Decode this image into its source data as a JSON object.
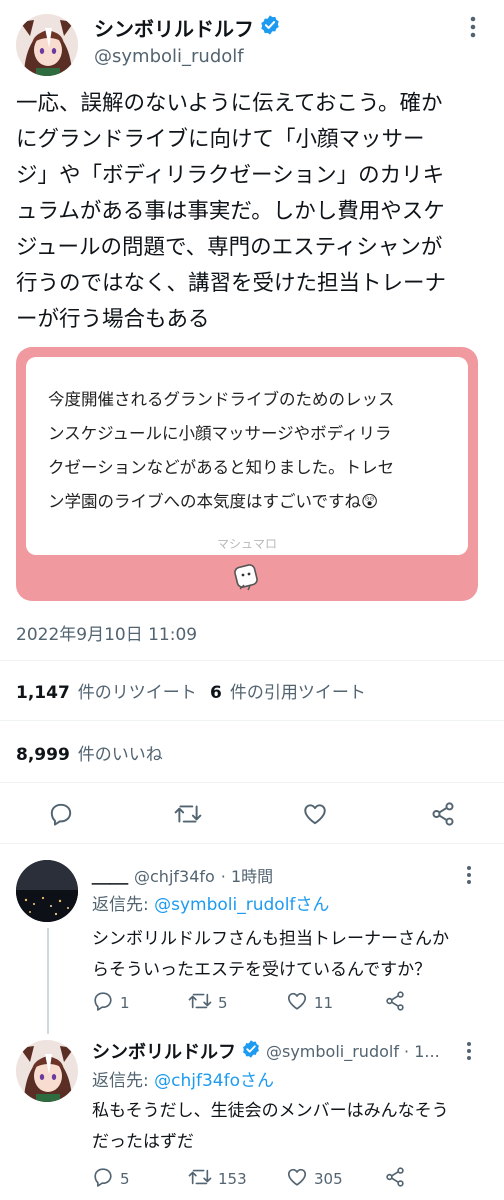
{
  "tweet": {
    "author_name": "シンボリルドルフ",
    "author_handle": "@symboli_rudolf",
    "text_lines": [
      "一応、誤解のないように伝えておこう。確か",
      "にグランドライブに向けて「小顔マッサー",
      "ジ」や「ボディリラクゼーション」のカリキ",
      "ュラムがある事は事実だ。しかし費用やスケ",
      "ジュールの問題で、専門のエスティシャンが",
      "行うのではなく、講習を受けた担当トレーナ",
      "ーが行う場合もある"
    ],
    "quote": {
      "text_lines": [
        "今度開催されるグランドライブのためのレッス",
        "ンスケジュールに小顔マッサージやボディリラ",
        "クゼーションなどがあると知りました。トレセ",
        "ン学園のライブへの本気度はすごいですね😲"
      ],
      "brand": "マシュマロ"
    },
    "timestamp": "2022年9月10日 11:09",
    "retweets_count": "1,147",
    "retweets_label": "件のリツイート",
    "quotes_count": "6",
    "quotes_label": "件の引用ツイート",
    "likes_count": "8,999",
    "likes_label": "件のいいね"
  },
  "replies": [
    {
      "author_name": "＿＿",
      "author_handle": "@chjf34fo",
      "time": "· 1時間",
      "reply_to_label": "返信先: ",
      "reply_to_handle": "@symboli_rudolfさん",
      "text_lines": [
        "シンボリルドルフさんも担当トレーナーさんか",
        "らそういったエステを受けているんですか？"
      ],
      "reply_count": "1",
      "retweet_count": "5",
      "like_count": "11"
    },
    {
      "author_name": "シンボリルドルフ",
      "author_handle": "@symboli_rudolf · 1...",
      "reply_to_label": "返信先: ",
      "reply_to_handle": "@chjf34foさん",
      "text_lines": [
        "私もそうだし、生徒会のメンバーはみんなそう",
        "だったはずだ"
      ],
      "reply_count": "5",
      "retweet_count": "153",
      "like_count": "305"
    }
  ],
  "icons": {
    "verified": "verified-badge-icon",
    "more": "more-dots-icon",
    "reply": "reply-icon",
    "retweet": "retweet-icon",
    "like": "heart-icon",
    "share": "share-icon",
    "marshmallow": "marshmallow-logo-icon"
  },
  "colors": {
    "accent": "#1d9bf0",
    "card_pink": "#f09aa0",
    "secondary_text": "#536471"
  }
}
